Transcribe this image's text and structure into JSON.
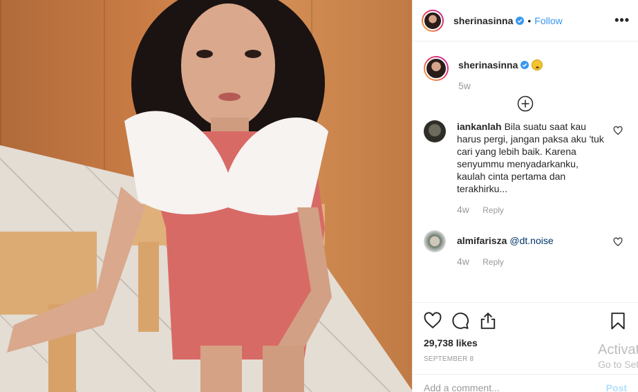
{
  "post": {
    "author": "sherinasinna",
    "follow_label": "Follow",
    "dot": "•",
    "more": "•••",
    "caption_time": "5w",
    "likes": "29,738 likes",
    "date": "September 8"
  },
  "comments": [
    {
      "username": "iankanlah",
      "text": "Bila suatu saat kau harus pergi, jangan paksa aku 'tuk cari yang lebih baik. Karena senyummu menyadarkanku, kaulah cinta pertama dan terakhirku...",
      "time": "4w",
      "reply_label": "Reply"
    },
    {
      "username": "almifarisza",
      "mention": "@dt.noise",
      "time": "4w",
      "reply_label": "Reply"
    }
  ],
  "add_comment": {
    "placeholder": "Add a comment...",
    "post_label": "Post"
  },
  "watermark": {
    "line1": "Activat",
    "line2": "Go to Set"
  },
  "colors": {
    "accent": "#3897f0",
    "text": "#262626",
    "muted": "#999999",
    "post_disabled": "#b2dffc"
  },
  "icons": [
    "verified-badge-icon",
    "emoji-icon",
    "plus-circle-icon",
    "heart-icon",
    "comment-icon",
    "share-icon",
    "bookmark-icon",
    "more-icon"
  ]
}
